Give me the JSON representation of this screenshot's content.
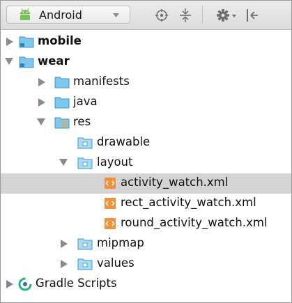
{
  "toolbar": {
    "view_selector": {
      "label": "Android",
      "icon": "android-robot-icon"
    },
    "icons": [
      "target-icon",
      "collapse-all-icon",
      "gear-icon",
      "hide-panel-icon"
    ],
    "colors": {
      "android_green": "#78c257",
      "background": "#e3e3e3"
    }
  },
  "tree": {
    "items": [
      {
        "label": "mobile",
        "icon": "module-folder-icon",
        "expanded": false,
        "bold": true
      },
      {
        "label": "wear",
        "icon": "module-folder-icon",
        "expanded": true,
        "bold": true
      },
      {
        "label": "manifests",
        "icon": "folder-icon",
        "expanded": false
      },
      {
        "label": "java",
        "icon": "folder-icon",
        "expanded": false
      },
      {
        "label": "res",
        "icon": "resource-folder-icon",
        "expanded": true
      },
      {
        "label": "drawable",
        "icon": "folder-icon"
      },
      {
        "label": "layout",
        "icon": "folder-icon",
        "expanded": true
      },
      {
        "label": "activity_watch.xml",
        "icon": "xml-layout-file-icon",
        "selected": true
      },
      {
        "label": "rect_activity_watch.xml",
        "icon": "xml-layout-file-icon"
      },
      {
        "label": "round_activity_watch.xml",
        "icon": "xml-layout-file-icon"
      },
      {
        "label": "mipmap",
        "icon": "folder-icon",
        "expanded": false
      },
      {
        "label": "values",
        "icon": "folder-icon",
        "expanded": false
      },
      {
        "label": "Gradle Scripts",
        "icon": "gradle-icon",
        "expanded": false
      }
    ],
    "colors": {
      "selection": "#d4d4d4",
      "folder_blue": "#7ec8ef",
      "res_orange": "#f1a33a",
      "xml_orange": "#f0923b"
    }
  }
}
